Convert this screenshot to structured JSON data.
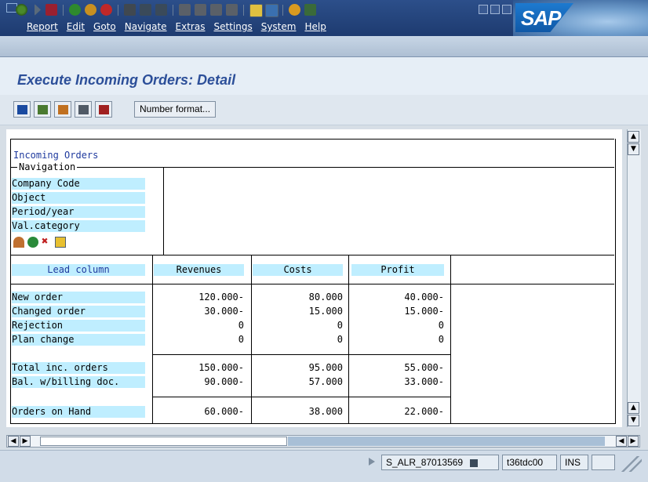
{
  "menu": [
    "Report",
    "Edit",
    "Goto",
    "Navigate",
    "Extras",
    "Settings",
    "System",
    "Help"
  ],
  "logo_text": "SAP",
  "page_title": "Execute Incoming Orders: Detail",
  "app_toolbar": {
    "number_format_label": "Number format..."
  },
  "report": {
    "header": "Incoming Orders",
    "navigation_label": "Navigation",
    "navigation_items": [
      "Company Code",
      "Object",
      "Period/year",
      "Val.category"
    ],
    "columns": [
      "Lead column",
      "Revenues",
      "Costs",
      "Profit"
    ],
    "group1": [
      {
        "label": "New order",
        "revenues": "120.000-",
        "costs": "80.000",
        "profit": "40.000-"
      },
      {
        "label": "Changed order",
        "revenues": "30.000-",
        "costs": "15.000",
        "profit": "15.000-"
      },
      {
        "label": "Rejection",
        "revenues": "0",
        "costs": "0",
        "profit": "0"
      },
      {
        "label": "Plan change",
        "revenues": "0",
        "costs": "0",
        "profit": "0"
      }
    ],
    "group2": [
      {
        "label": "Total inc. orders",
        "revenues": "150.000-",
        "costs": "95.000",
        "profit": "55.000-"
      },
      {
        "label": "Bal. w/billing doc.",
        "revenues": "90.000-",
        "costs": "57.000",
        "profit": "33.000-"
      }
    ],
    "group3": [
      {
        "label": "Orders on Hand",
        "revenues": "60.000-",
        "costs": "38.000",
        "profit": "22.000-"
      }
    ]
  },
  "status": {
    "transaction": "S_ALR_87013569",
    "server": "t36tdc00",
    "mode": "INS"
  },
  "colors": {
    "title_blue": "#2c4f99",
    "cyan": "#bfeeff",
    "menubar": "#1e3b70"
  }
}
